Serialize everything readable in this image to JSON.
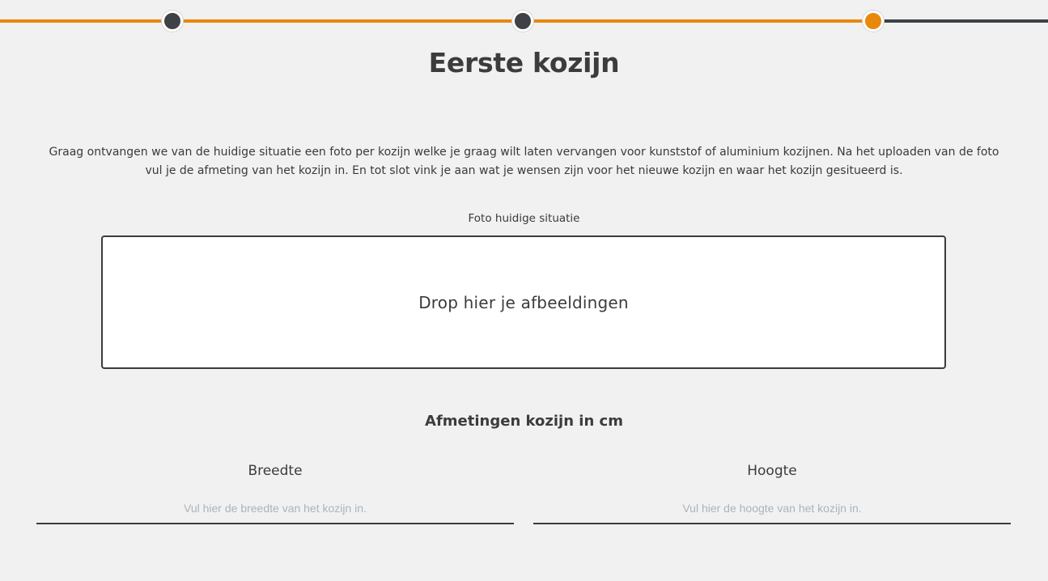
{
  "stepper": {
    "steps": [
      {
        "status": "done"
      },
      {
        "status": "done"
      },
      {
        "status": "active"
      }
    ],
    "colors": {
      "done_line": "#e8890c",
      "todo_line": "#3e4246",
      "active": "#e8890c",
      "done_dot": "#3e4246"
    }
  },
  "page": {
    "title": "Eerste kozijn",
    "intro": "Graag ontvangen we van de huidige situatie een foto per kozijn welke je graag wilt laten vervangen voor kunststof of aluminium kozijnen. Na het uploaden van de foto vul je de afmeting van het kozijn in. En tot slot vink je aan wat je wensen zijn voor het nieuwe kozijn en waar het kozijn gesitueerd is."
  },
  "photo": {
    "label": "Foto huidige situatie",
    "dropzone_text": "Drop hier je afbeeldingen"
  },
  "dimensions": {
    "title": "Afmetingen kozijn in cm",
    "width": {
      "label": "Breedte",
      "value": "",
      "placeholder": "Vul hier de breedte van het kozijn in."
    },
    "height": {
      "label": "Hoogte",
      "value": "",
      "placeholder": "Vul hier de hoogte van het kozijn in."
    }
  }
}
